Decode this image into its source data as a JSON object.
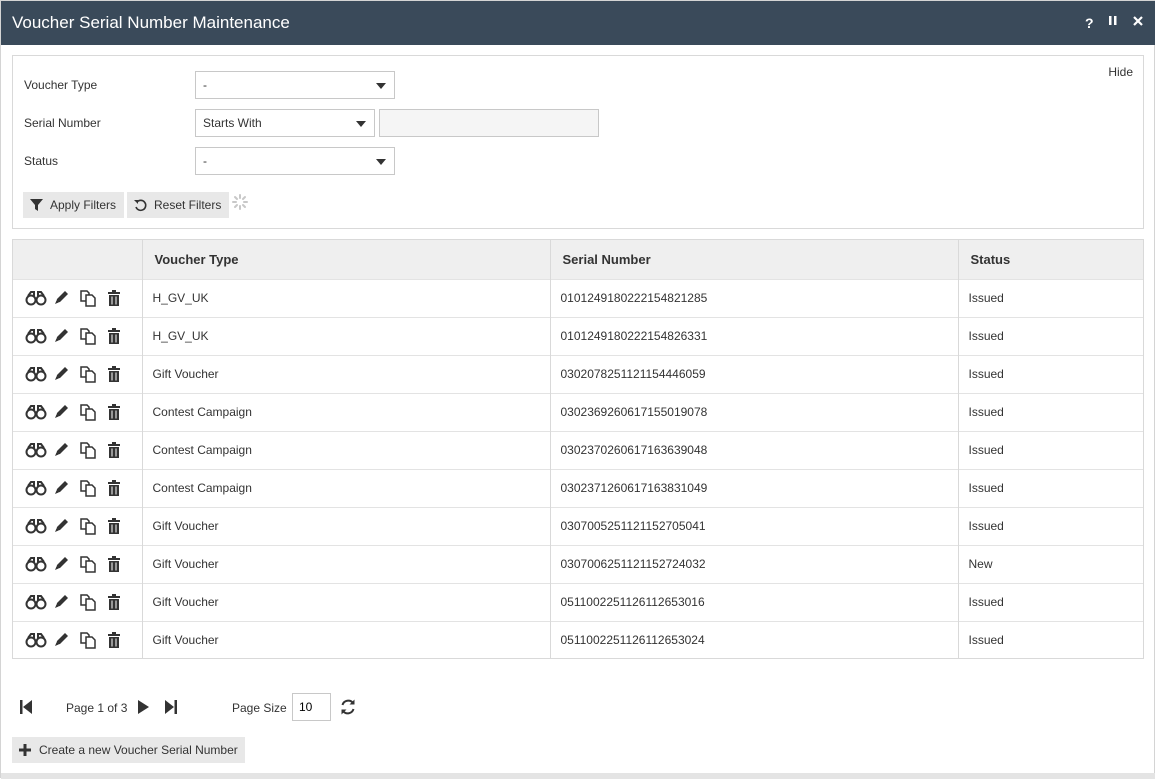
{
  "window": {
    "title": "Voucher Serial Number Maintenance",
    "help_label": "?",
    "pause_label": "II",
    "close_label": "✕"
  },
  "filters": {
    "hide_label": "Hide",
    "voucher_type": {
      "label": "Voucher Type",
      "value": "-"
    },
    "serial_number": {
      "label": "Serial Number",
      "operator": "Starts With",
      "value": ""
    },
    "status": {
      "label": "Status",
      "value": "-"
    },
    "apply_label": "Apply Filters",
    "reset_label": "Reset Filters"
  },
  "grid": {
    "columns": [
      "",
      "Voucher Type",
      "Serial Number",
      "Status"
    ],
    "rows": [
      {
        "type": "H_GV_UK",
        "serial": "0101249180222154821285",
        "status": "Issued"
      },
      {
        "type": "H_GV_UK",
        "serial": "0101249180222154826331",
        "status": "Issued"
      },
      {
        "type": "Gift Voucher",
        "serial": "0302078251121154446059",
        "status": "Issued"
      },
      {
        "type": "Contest Campaign",
        "serial": "0302369260617155019078",
        "status": "Issued"
      },
      {
        "type": "Contest Campaign",
        "serial": "0302370260617163639048",
        "status": "Issued"
      },
      {
        "type": "Contest Campaign",
        "serial": "0302371260617163831049",
        "status": "Issued"
      },
      {
        "type": "Gift Voucher",
        "serial": "0307005251121152705041",
        "status": "Issued"
      },
      {
        "type": "Gift Voucher",
        "serial": "0307006251121152724032",
        "status": "New"
      },
      {
        "type": "Gift Voucher",
        "serial": "0511002251126112653016",
        "status": "Issued"
      },
      {
        "type": "Gift Voucher",
        "serial": "0511002251126112653024",
        "status": "Issued"
      }
    ],
    "row_actions": [
      "view-icon",
      "edit-icon",
      "copy-icon",
      "delete-icon"
    ]
  },
  "pager": {
    "page_text": "Page 1 of 3",
    "page_size_label": "Page Size",
    "page_size": "10"
  },
  "create_label": "Create a new Voucher Serial Number",
  "colors": {
    "titlebar": "#3a4a5a",
    "button_bg": "#e8e8e8",
    "header_bg": "#efefef"
  }
}
